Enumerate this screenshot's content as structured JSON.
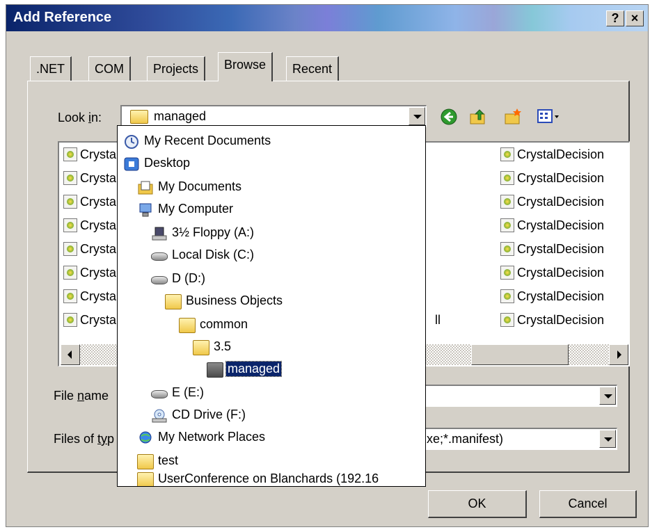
{
  "window": {
    "title": "Add Reference",
    "help_label": "?",
    "close_label": "×"
  },
  "tabs": [
    {
      "label": ".NET",
      "active": false
    },
    {
      "label": "COM",
      "active": false
    },
    {
      "label": "Projects",
      "active": false
    },
    {
      "label": "Browse",
      "active": true
    },
    {
      "label": "Recent",
      "active": false
    }
  ],
  "look_in": {
    "label_pre": "Look ",
    "label_key": "i",
    "label_post": "n:",
    "value": "managed"
  },
  "files": {
    "left_column": [
      "Crysta",
      "Crysta",
      "Crysta",
      "Crysta",
      "Crysta",
      "Crysta",
      "Crysta",
      "Crysta"
    ],
    "right_column": [
      "CrystalDecision",
      "CrystalDecision",
      "CrystalDecision",
      "CrystalDecision",
      "CrystalDecision",
      "CrystalDecision",
      "CrystalDecision",
      "CrystalDecision"
    ],
    "middle_fragment": "ll"
  },
  "file_name": {
    "label_pre": "File ",
    "label_key": "n",
    "label_post": "ame",
    "value": ""
  },
  "files_of_type": {
    "label_pre": "Files of ",
    "label_key": "ty",
    "label_post": "p",
    "value": "xe;*.manifest)"
  },
  "dropdown_items": [
    {
      "label": "My Recent Documents",
      "icon": "recent-documents-icon"
    },
    {
      "label": "Desktop",
      "icon": "desktop-icon"
    },
    {
      "label": "My Documents",
      "icon": "my-documents-icon"
    },
    {
      "label": "My Computer",
      "icon": "my-computer-icon"
    },
    {
      "label": "3½ Floppy (A:)",
      "icon": "floppy-drive-icon"
    },
    {
      "label": "Local Disk (C:)",
      "icon": "hard-drive-icon"
    },
    {
      "label": "D (D:)",
      "icon": "hard-drive-icon"
    },
    {
      "label": "Business Objects",
      "icon": "folder-icon"
    },
    {
      "label": "common",
      "icon": "folder-icon"
    },
    {
      "label": "3.5",
      "icon": "folder-icon"
    },
    {
      "label": "managed",
      "icon": "folder-icon"
    },
    {
      "label": "E (E:)",
      "icon": "hard-drive-icon"
    },
    {
      "label": "CD Drive (F:)",
      "icon": "cd-drive-icon"
    },
    {
      "label": "My Network Places",
      "icon": "network-places-icon"
    },
    {
      "label": "test",
      "icon": "folder-icon"
    },
    {
      "label": "UserConference on Blanchards (192.16",
      "icon": "network-folder-icon"
    }
  ],
  "buttons": {
    "ok": "OK",
    "cancel": "Cancel"
  }
}
